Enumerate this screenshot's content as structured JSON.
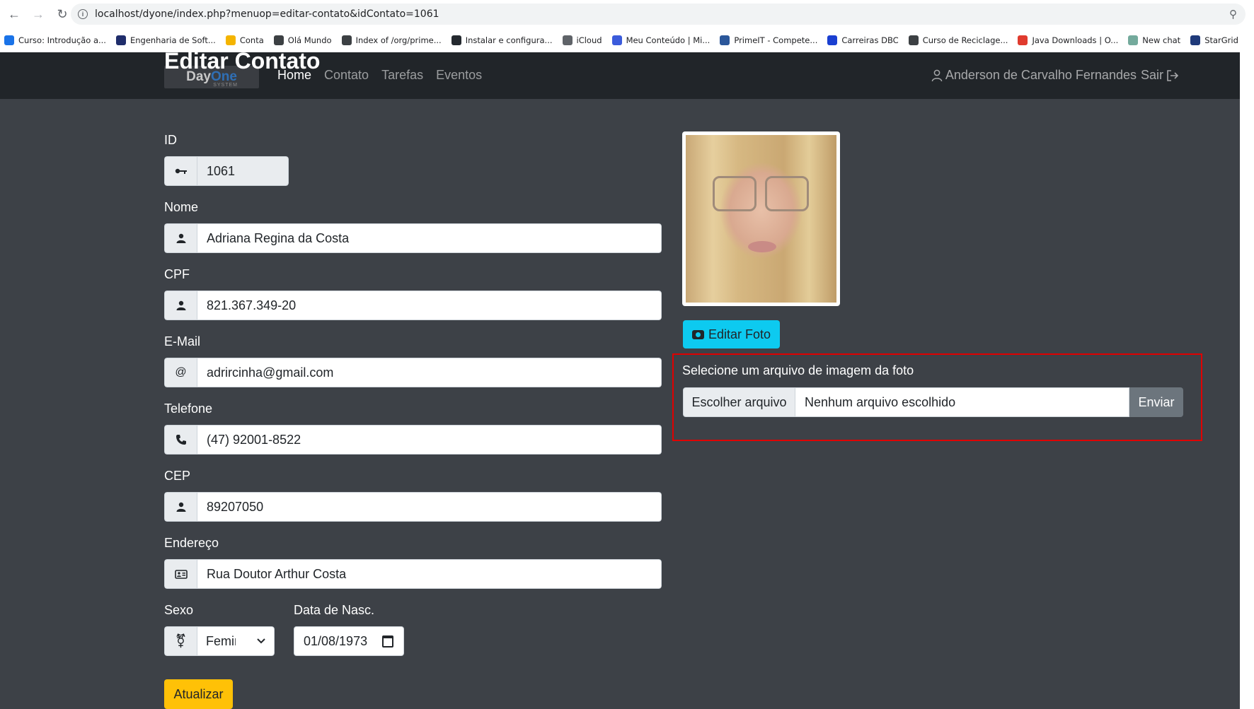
{
  "browser": {
    "url": "localhost/dyone/index.php?menuop=editar-contato&idContato=1061",
    "bookmarks": [
      {
        "label": "Curso: Introdução a...",
        "color": "#1a73e8"
      },
      {
        "label": "Engenharia de Soft...",
        "color": "#1f2d6b"
      },
      {
        "label": "Conta",
        "color": "#f4b400"
      },
      {
        "label": "Olá Mundo",
        "color": "#3c4043"
      },
      {
        "label": "Index of /org/prime...",
        "color": "#3c4043"
      },
      {
        "label": "Instalar e configura...",
        "color": "#24292f"
      },
      {
        "label": "iCloud",
        "color": "#5f6368"
      },
      {
        "label": "Meu Conteúdo | Mi...",
        "color": "#3b5bdb"
      },
      {
        "label": "PrimeIT - Compete...",
        "color": "#2b579a"
      },
      {
        "label": "Carreiras DBC",
        "color": "#1a3fd1"
      },
      {
        "label": "Curso de Reciclage...",
        "color": "#3c4043"
      },
      {
        "label": "Java Downloads | O...",
        "color": "#e03b2e"
      },
      {
        "label": "New chat",
        "color": "#74aa9c"
      },
      {
        "label": "StarGrid",
        "color": "#1f3a7a"
      }
    ]
  },
  "navbar": {
    "brand_day": "Day",
    "brand_one": "One",
    "brand_system": "SYSTEM",
    "links": [
      "Home",
      "Contato",
      "Tarefas",
      "Eventos"
    ],
    "user": "Anderson de Carvalho Fernandes",
    "logout": "Sair"
  },
  "form": {
    "title": "Editar Contato",
    "id_label": "ID",
    "id_value": "1061",
    "nome_label": "Nome",
    "nome_value": "Adriana Regina da Costa",
    "cpf_label": "CPF",
    "cpf_value": "821.367.349-20",
    "email_label": "E-Mail",
    "email_value": "adrircinha@gmail.com",
    "email_prefix": "@",
    "telefone_label": "Telefone",
    "telefone_value": "(47) 92001-8522",
    "cep_label": "CEP",
    "cep_value": "89207050",
    "endereco_label": "Endereço",
    "endereco_value": "Rua Doutor Arthur Costa",
    "sexo_label": "Sexo",
    "sexo_value": "Feminino",
    "nasc_label": "Data de Nasc.",
    "nasc_value": "01/08/1973",
    "update_button": "Atualizar"
  },
  "photo": {
    "edit_button": "Editar Foto",
    "upload_label": "Selecione um arquivo de imagem da foto",
    "choose_button": "Escolher arquivo",
    "no_file": "Nenhum arquivo escolhido",
    "send_button": "Enviar"
  }
}
